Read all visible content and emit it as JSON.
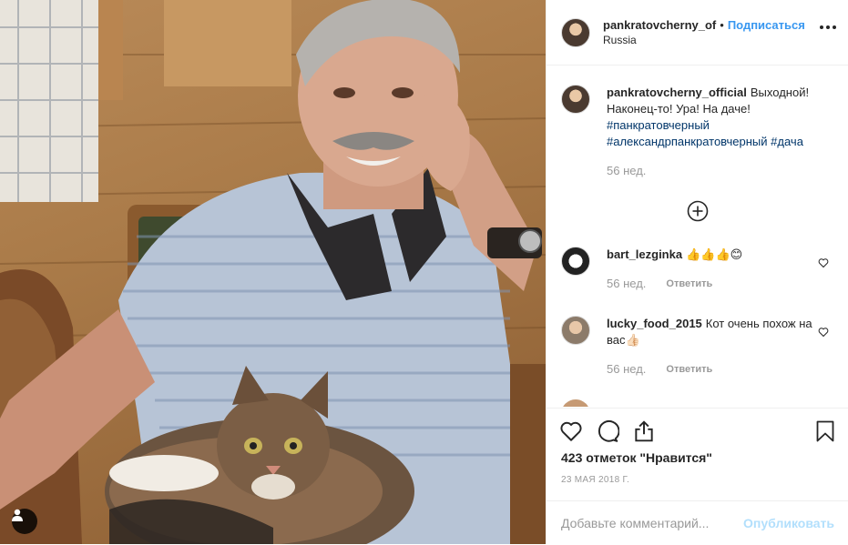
{
  "header": {
    "username": "pankratovcherny_of",
    "separator": "•",
    "follow_label": "Подписаться",
    "location": "Russia",
    "more_icon": "more-horizontal-icon"
  },
  "caption": {
    "username": "pankratovcherny_official",
    "text": "Выходной! Наконец-то! Ура! На даче!",
    "hashtags": [
      "#панкратовчерный",
      "#александрпанкратовчерный",
      "#дача"
    ],
    "time": "56 нед."
  },
  "load_more_icon": "plus-circle-icon",
  "comments": [
    {
      "username": "bart_lezginka",
      "text": "👍👍👍😊",
      "time": "56 нед.",
      "reply_label": "Ответить"
    },
    {
      "username": "lucky_food_2015",
      "text": "Кот очень похож на вас👍🏻",
      "time": "56 нед.",
      "reply_label": "Ответить"
    }
  ],
  "action_icons": [
    "heart-icon",
    "comment-icon",
    "share-icon",
    "bookmark-icon"
  ],
  "likes_text": "423 отметок \"Нравится\"",
  "date_text": "23 МАЯ 2018 Г.",
  "comment_input": {
    "placeholder": "Добавьте комментарий...",
    "publish_label": "Опубликовать"
  },
  "colors": {
    "link": "#3897f0",
    "hashtag": "#003569",
    "muted": "#999999",
    "publish_disabled": "#b2dffc"
  }
}
